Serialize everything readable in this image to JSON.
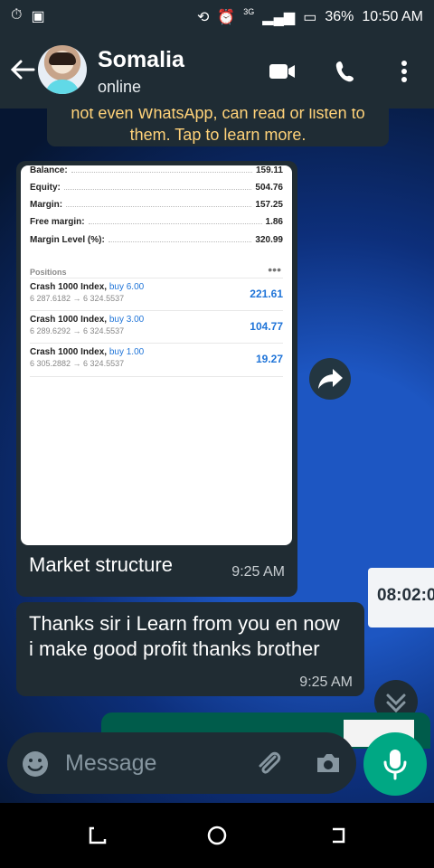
{
  "status_bar": {
    "network": "3G",
    "battery": "36%",
    "time": "10:50 AM"
  },
  "app_bar": {
    "contact_name": "Somalia",
    "status": "online",
    "icons": [
      "back-arrow-icon",
      "video-call-icon",
      "phone-icon",
      "more-vertical-icon"
    ]
  },
  "encryption_notice": {
    "line1": "not even WhatsApp, can read or listen to",
    "line2": "them. Tap to learn more."
  },
  "image_message": {
    "caption": "Market structure",
    "time": "9:25 AM",
    "screenshot": {
      "summary": [
        {
          "label": "Balance:",
          "value": "159.11"
        },
        {
          "label": "Equity:",
          "value": "504.76"
        },
        {
          "label": "Margin:",
          "value": "157.25"
        },
        {
          "label": "Free margin:",
          "value": "1.86"
        },
        {
          "label": "Margin Level (%):",
          "value": "320.99"
        }
      ],
      "positions_title": "Positions",
      "positions_menu": "•••",
      "positions": [
        {
          "symbol": "Crash 1000 Index,",
          "side": "buy 6.00",
          "range": "6 287.6182 → 6 324.5537",
          "profit": "221.61"
        },
        {
          "symbol": "Crash 1000 Index,",
          "side": "buy 3.00",
          "range": "6 289.6292 → 6 324.5537",
          "profit": "104.77"
        },
        {
          "symbol": "Crash 1000 Index,",
          "side": "buy 1.00",
          "range": "6 305.2882 → 6 324.5537",
          "profit": "19.27"
        }
      ]
    }
  },
  "text_message": {
    "text": "Thanks sir i Learn from you en now i make good profit thanks brother",
    "time": "9:25 AM"
  },
  "background_clock": "08:02:0",
  "composer": {
    "placeholder": "Message",
    "icons": [
      "emoji-icon",
      "attach-icon",
      "camera-icon",
      "mic-icon"
    ]
  },
  "colors": {
    "header": "#1f2c34",
    "bubble": "#202c33",
    "accent": "#00a884",
    "notice_text": "#ffd279"
  }
}
